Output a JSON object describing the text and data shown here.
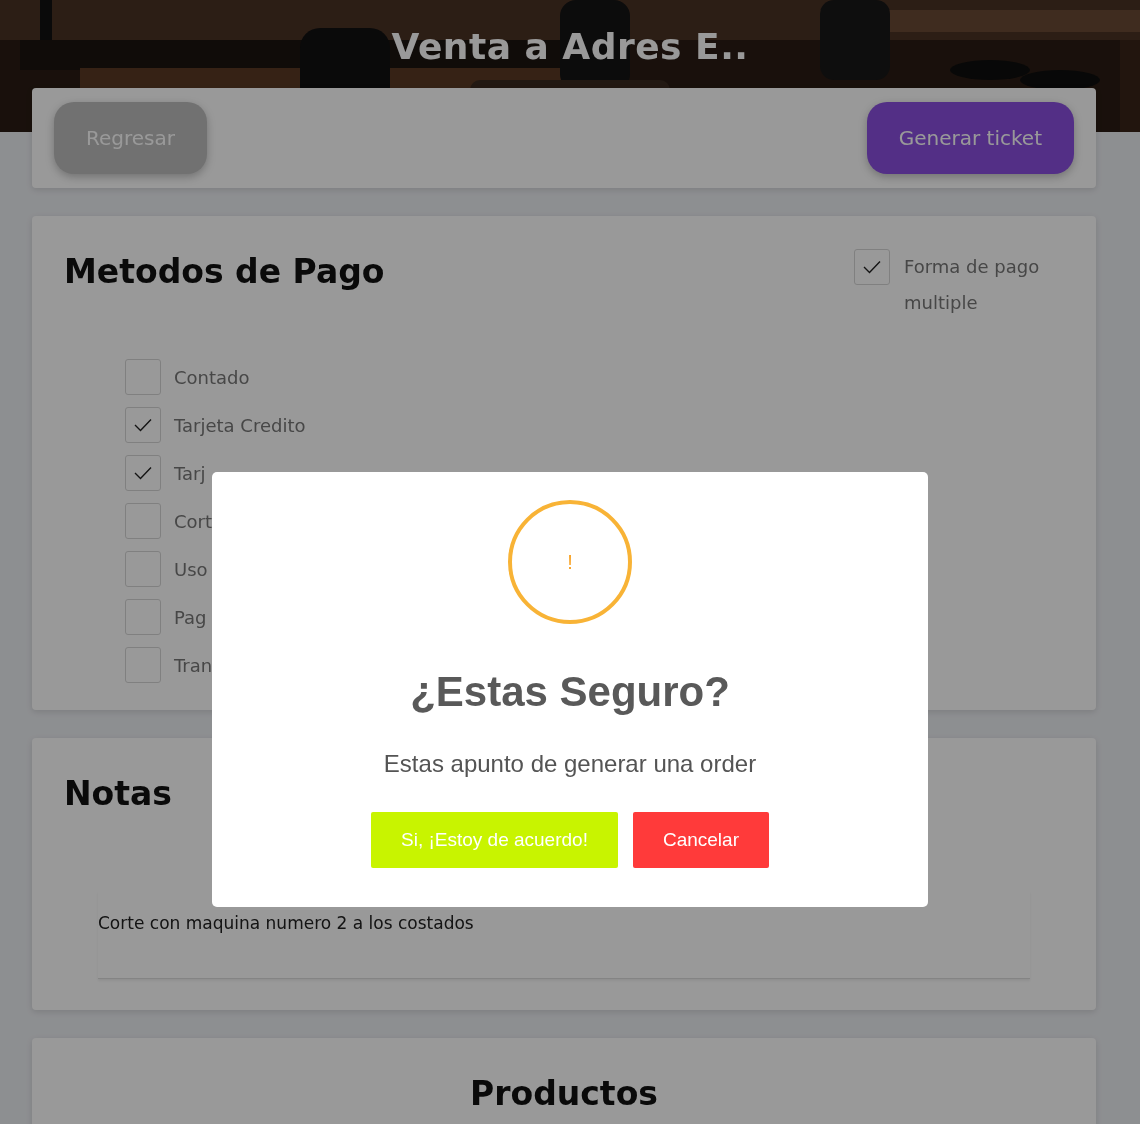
{
  "header": {
    "title": "Venta a Adres E.."
  },
  "toolbar": {
    "back_button": "Regresar",
    "ticket_button": "Generar ticket"
  },
  "payment": {
    "title": "Metodos de Pago",
    "multiple": {
      "label": "Forma de pago multiple",
      "checked": true
    },
    "methods": [
      {
        "label": "Contado",
        "checked": false
      },
      {
        "label": "Tarjeta Credito",
        "checked": true
      },
      {
        "label": "Tarj",
        "checked": true
      },
      {
        "label": "Cort",
        "checked": false
      },
      {
        "label": "Uso",
        "checked": false
      },
      {
        "label": "Pag",
        "checked": false
      },
      {
        "label": "Tran",
        "checked": false
      }
    ]
  },
  "notes": {
    "title": "Notas",
    "value": "Corte con maquina numero 2 a los costados"
  },
  "products": {
    "title": "Productos"
  },
  "dialog": {
    "icon": "!",
    "title": "¿Estas Seguro?",
    "text": "Estas apunto de generar una order",
    "confirm_button": "Si, ¡Estoy de acuerdo!",
    "cancel_button": "Cancelar"
  }
}
